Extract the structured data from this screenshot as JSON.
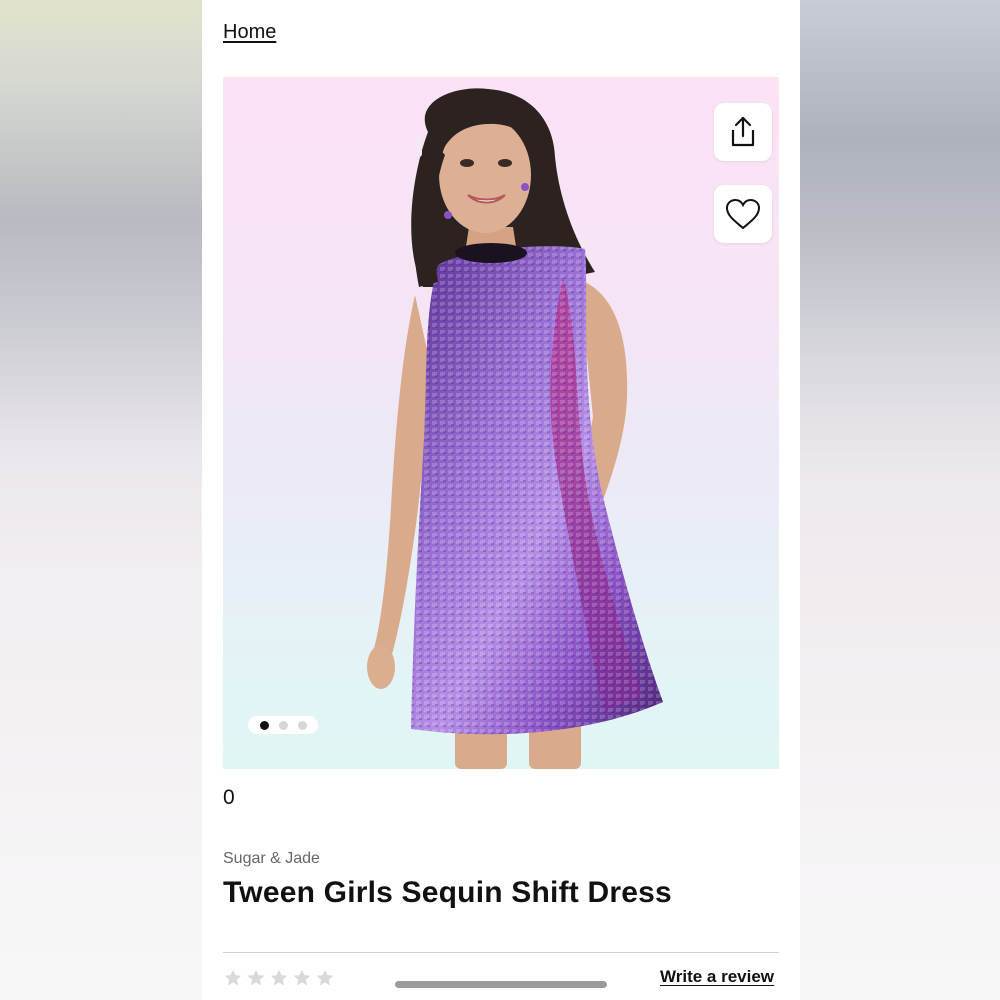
{
  "breadcrumb": {
    "home_label": "Home"
  },
  "gallery": {
    "image_alt": "Tween Girls Sequin Shift Dress",
    "slide_count": 3,
    "active_slide": 1
  },
  "actions": {
    "share_icon": "share-icon",
    "favorite_icon": "heart-icon"
  },
  "product": {
    "count": "0",
    "brand": "Sugar & Jade",
    "title": "Tween Girls Sequin Shift Dress"
  },
  "reviews": {
    "rating": 0,
    "max_rating": 5,
    "write_review_label": "Write a review"
  },
  "colors": {
    "text": "#111111",
    "brand_text": "#666666",
    "star_empty": "#d9d9d9",
    "dress_purple": "#7a4cb5"
  }
}
